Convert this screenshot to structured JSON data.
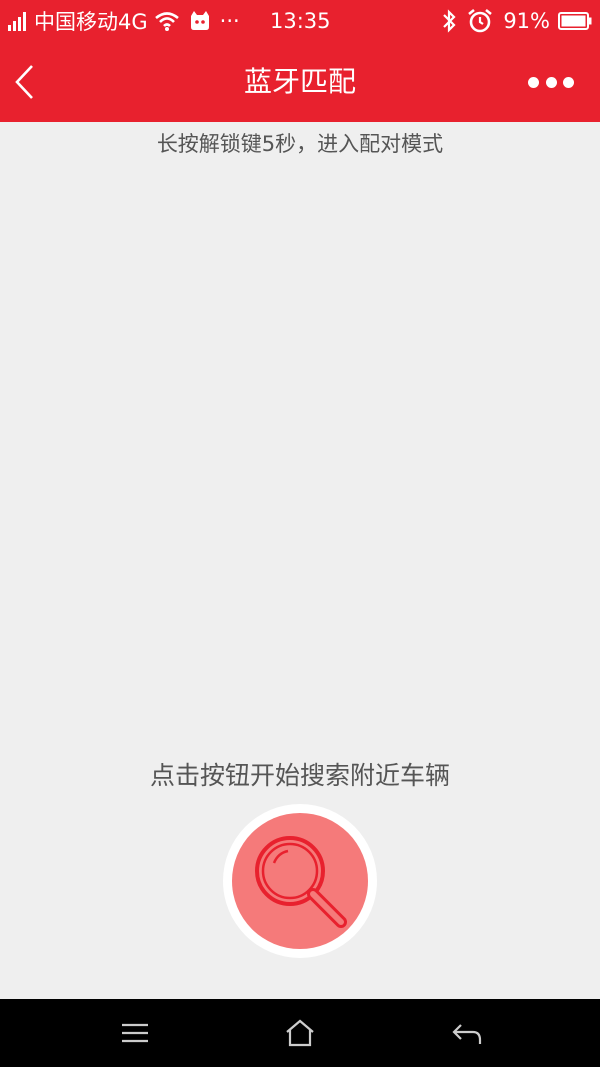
{
  "status_bar": {
    "carrier": "中国移动4G",
    "dots": "···",
    "time": "13:35",
    "battery": "91%",
    "icons": [
      "signal-icon",
      "wifi-icon",
      "notification-cat-icon",
      "bluetooth-icon",
      "alarm-icon",
      "battery-icon"
    ]
  },
  "nav": {
    "title": "蓝牙匹配",
    "back_icon": "chevron-left-icon",
    "more_icon": "more-dots-icon"
  },
  "main": {
    "instruction": "长按解锁键5秒，进入配对模式",
    "search_hint": "点击按钮开始搜索附近车辆",
    "search_icon": "magnifier-icon"
  },
  "system_nav": {
    "icons": [
      "menu-icon",
      "home-icon",
      "back-arrow-icon"
    ]
  },
  "colors": {
    "brand_red": "#e8212e",
    "button_fill": "#f57a7a",
    "background": "#efefef"
  }
}
